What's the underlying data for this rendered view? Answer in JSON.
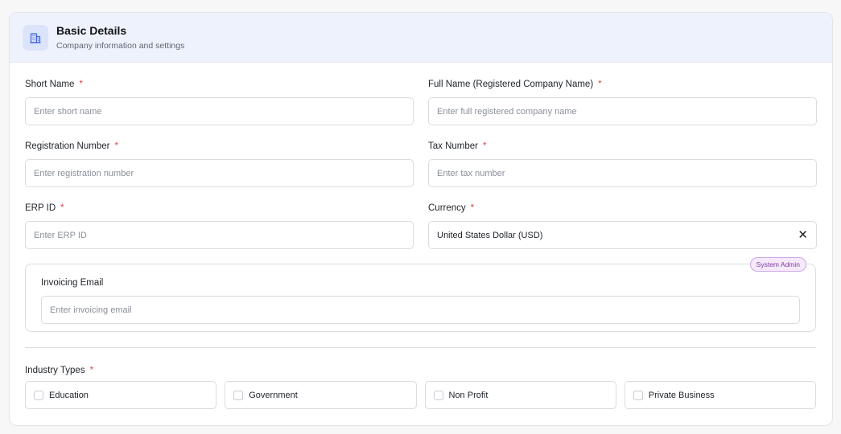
{
  "header": {
    "icon": "building-icon",
    "title": "Basic Details",
    "subtitle": "Company information and settings"
  },
  "fields": {
    "short_name": {
      "label": "Short Name",
      "required": "*",
      "placeholder": "Enter short name",
      "value": ""
    },
    "full_name": {
      "label": "Full Name (Registered Company Name)",
      "required": "*",
      "placeholder": "Enter full registered company name",
      "value": ""
    },
    "registration_number": {
      "label": "Registration Number",
      "required": "*",
      "placeholder": "Enter registration number",
      "value": ""
    },
    "tax_number": {
      "label": "Tax Number",
      "required": "*",
      "placeholder": "Enter tax number",
      "value": ""
    },
    "erp_id": {
      "label": "ERP ID",
      "required": "*",
      "placeholder": "Enter ERP ID",
      "value": ""
    },
    "currency": {
      "label": "Currency",
      "required": "*",
      "value": "United States Dollar (USD)",
      "clear_icon": "close-icon",
      "clear_glyph": "✕"
    }
  },
  "admin_section": {
    "badge": "System Admin",
    "invoicing_email": {
      "label": "Invoicing Email",
      "placeholder": "Enter invoicing email",
      "value": ""
    }
  },
  "industry": {
    "label": "Industry Types",
    "required": "*",
    "options": [
      {
        "label": "Education",
        "checked": false
      },
      {
        "label": "Government",
        "checked": false
      },
      {
        "label": "Non Profit",
        "checked": false
      },
      {
        "label": "Private Business",
        "checked": false
      }
    ]
  },
  "colors": {
    "header_bg": "#eef2fd",
    "required": "#e0404a",
    "badge_bg": "#f5e9fb",
    "badge_text": "#7b3f9a"
  }
}
